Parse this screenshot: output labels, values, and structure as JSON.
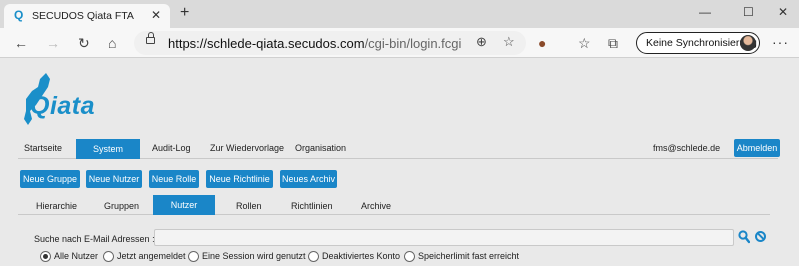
{
  "browser": {
    "tab_title": "SECUDOS Qiata FTA",
    "tab_favicon": "Q",
    "url_host": "https://schlede-qiata.secudos.com",
    "url_path": "/cgi-bin/login.fcgi",
    "sync_label": "Keine Synchronisierung"
  },
  "app": {
    "logo_text": "Qiata",
    "user_email": "fms@schlede.de",
    "logout_label": "Abmelden",
    "accent_color": "#1a86c8"
  },
  "main_nav": [
    "Startseite",
    "System",
    "Audit-Log",
    "Zur Wiedervorlage",
    "Organisation"
  ],
  "main_nav_active": "System",
  "actions": [
    "Neue Gruppe",
    "Neue Nutzer",
    "Neue Rolle",
    "Neue Richtlinie",
    "Neues Archiv"
  ],
  "sub_nav": [
    "Hierarchie",
    "Gruppen",
    "Nutzer",
    "Rollen",
    "Richtlinien",
    "Archive"
  ],
  "sub_nav_active": "Nutzer",
  "search": {
    "label": "Suche nach E-Mail Adressen :",
    "value": ""
  },
  "filters": [
    "Alle Nutzer",
    "Jetzt angemeldet",
    "Eine Session wird genutzt",
    "Deaktiviertes Konto",
    "Speicherlimit fast erreicht"
  ],
  "filter_selected": "Alle Nutzer"
}
